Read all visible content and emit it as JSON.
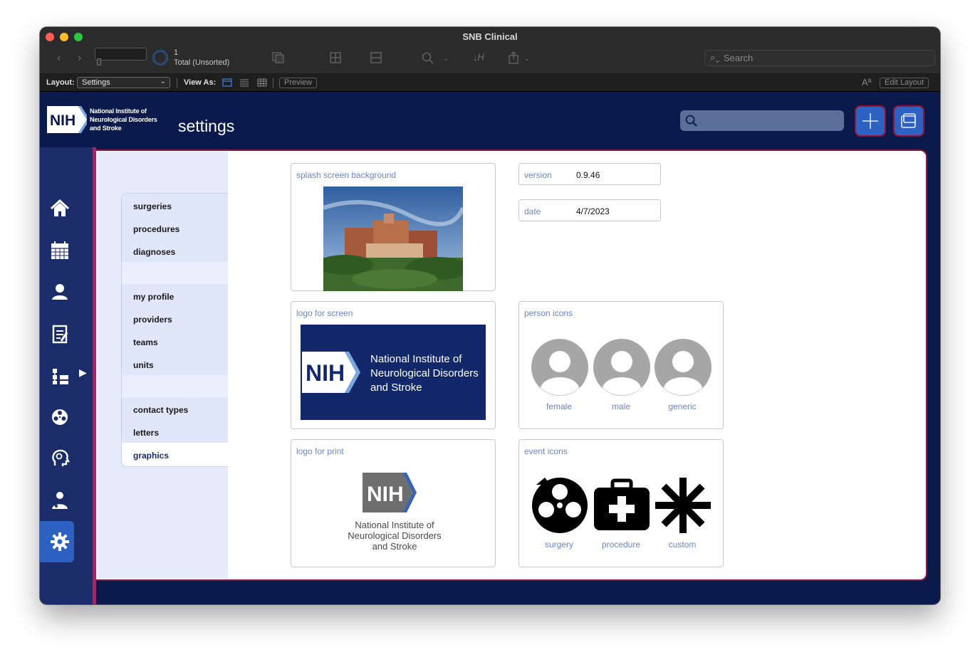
{
  "window": {
    "title": "SNB Clinical",
    "record_count": "1",
    "record_status": "Total (Unsorted)",
    "search_placeholder": "Search"
  },
  "layout_bar": {
    "layout_label": "Layout:",
    "layout_value": "Settings",
    "view_as_label": "View As:",
    "preview_label": "Preview",
    "font_glyph": "Aª",
    "edit_layout_label": "Edit Layout"
  },
  "header": {
    "logo_mark": "NIH",
    "logo_line1": "National Institute of",
    "logo_line2": "Neurological Disorders",
    "logo_line3": "and Stroke",
    "page_title": "settings"
  },
  "nav_icons": [
    "home-icon",
    "calendar-icon",
    "person-icon",
    "clipboard-icon",
    "hierarchy-icon",
    "reel-icon",
    "head-icon",
    "doctor-icon",
    "gear-icon"
  ],
  "settings_menu": {
    "group1": [
      "surgeries",
      "procedures",
      "diagnoses"
    ],
    "group2": [
      "my profile",
      "providers",
      "teams",
      "units"
    ],
    "group3": [
      "contact types",
      "letters",
      "graphics"
    ],
    "active": "graphics"
  },
  "graphics": {
    "splash_label": "splash screen background",
    "logo_screen_label": "logo for screen",
    "logo_print_label": "logo for print",
    "version_label": "version",
    "version_value": "0.9.46",
    "date_label": "date",
    "date_value": "4/7/2023",
    "person_icons_label": "person icons",
    "person_female": "female",
    "person_male": "male",
    "person_generic": "generic",
    "event_icons_label": "event icons",
    "event_surgery": "surgery",
    "event_procedure": "procedure",
    "event_custom": "custom"
  },
  "colors": {
    "header_navy": "#0b1a4c",
    "rail_blue": "#1a2d6a",
    "accent_blue": "#2d62c2",
    "label_blue": "#6a86c9",
    "border_crimson": "#8a1a3e"
  }
}
